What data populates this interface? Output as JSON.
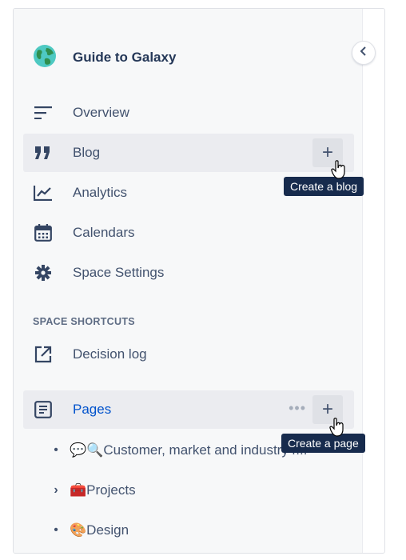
{
  "space": {
    "title": "Guide to Galaxy",
    "icon": "globe-icon"
  },
  "nav": {
    "overview": "Overview",
    "blog": "Blog",
    "analytics": "Analytics",
    "calendars": "Calendars",
    "space_settings": "Space Settings"
  },
  "shortcuts": {
    "section_title": "SPACE SHORTCUTS",
    "decision_log": "Decision log"
  },
  "pages": {
    "label": "Pages"
  },
  "buttons": {
    "plus": "+",
    "more": "•••"
  },
  "tooltips": {
    "create_blog": "Create a blog",
    "create_page": "Create a page"
  },
  "tree": {
    "bullet": "•",
    "chevron": "›",
    "items": [
      {
        "emoji": "💬🔍",
        "label": "Customer, market and industry r..."
      },
      {
        "emoji": "🧰",
        "label": "Projects"
      },
      {
        "emoji": "🎨",
        "label": "Design"
      }
    ]
  },
  "colors": {
    "link": "#0052cc",
    "tooltip_bg": "#172b4d",
    "active_bg": "#ebecf0"
  }
}
